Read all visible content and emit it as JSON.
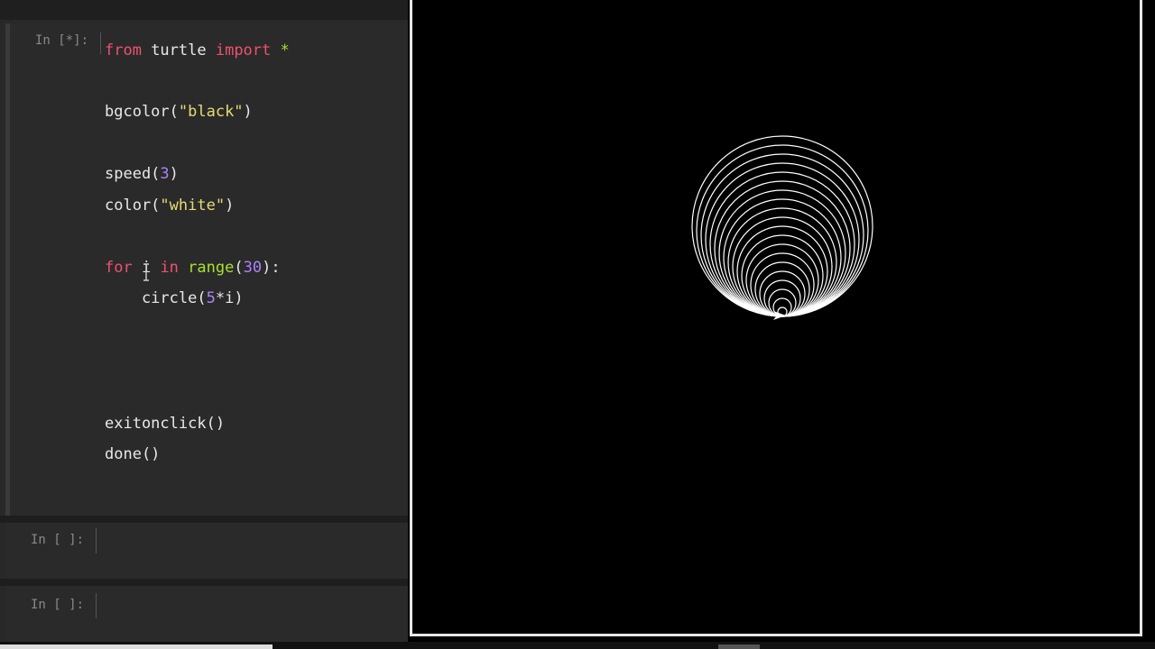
{
  "notebook": {
    "cells": [
      {
        "prompt": "In [*]:",
        "lines": [
          [
            {
              "t": "kw",
              "v": "from"
            },
            {
              "t": "plain",
              "v": " turtle "
            },
            {
              "t": "kw",
              "v": "import"
            },
            {
              "t": "plain",
              "v": " "
            },
            {
              "t": "fn",
              "v": "*"
            }
          ],
          [
            {
              "t": "plain",
              "v": "bgcolor("
            },
            {
              "t": "str",
              "v": "\"black\""
            },
            {
              "t": "plain",
              "v": ")"
            }
          ],
          [
            {
              "t": "plain",
              "v": "speed("
            },
            {
              "t": "num",
              "v": "3"
            },
            {
              "t": "plain",
              "v": ")"
            }
          ],
          [
            {
              "t": "plain",
              "v": "color("
            },
            {
              "t": "str",
              "v": "\"white\""
            },
            {
              "t": "plain",
              "v": ")"
            }
          ],
          [
            {
              "t": "kw",
              "v": "for"
            },
            {
              "t": "plain",
              "v": " i "
            },
            {
              "t": "kw",
              "v": "in"
            },
            {
              "t": "plain",
              "v": " "
            },
            {
              "t": "fn",
              "v": "range"
            },
            {
              "t": "plain",
              "v": "("
            },
            {
              "t": "num",
              "v": "30"
            },
            {
              "t": "plain",
              "v": "):"
            }
          ],
          [
            {
              "t": "plain",
              "v": "    circle("
            },
            {
              "t": "num",
              "v": "5"
            },
            {
              "t": "plain",
              "v": "*i)"
            }
          ],
          [
            {
              "t": "plain",
              "v": "exitonclick()"
            }
          ],
          [
            {
              "t": "plain",
              "v": "done()"
            }
          ]
        ]
      },
      {
        "prompt": "In [ ]:"
      },
      {
        "prompt": "In [ ]:"
      }
    ]
  },
  "turtle_canvas": {
    "background": "#000000",
    "stroke": "#ffffff",
    "circle_count": 20,
    "radius_step": 5
  },
  "colors": {
    "keyword": "#f0506e",
    "builtin": "#a6e22e",
    "string": "#e6db74",
    "number": "#ae81ff"
  }
}
